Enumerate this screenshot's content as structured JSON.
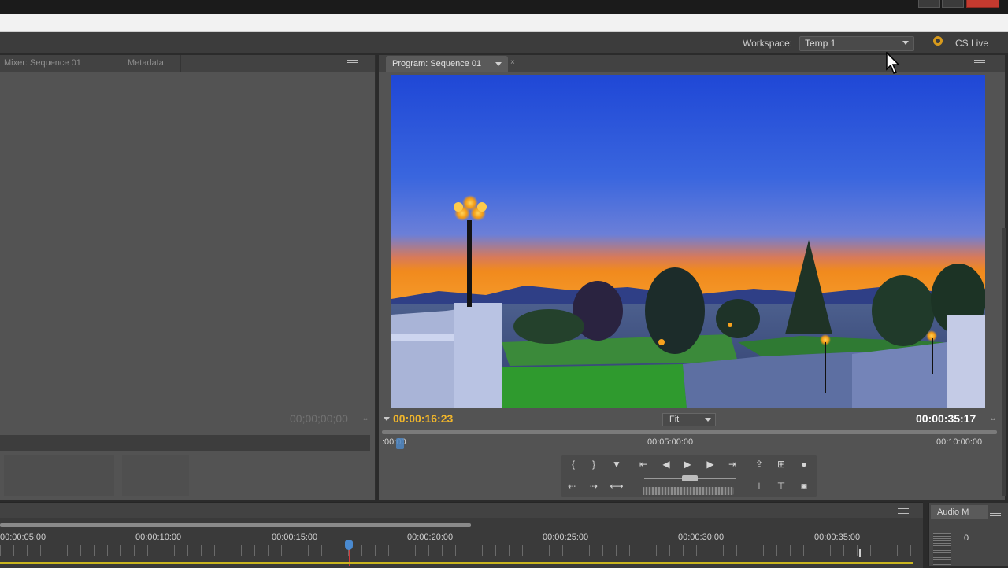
{
  "workspace": {
    "label": "Workspace:",
    "value": "Temp 1",
    "cs_live": "CS Live"
  },
  "left_panel": {
    "tabs": [
      "Mixer: Sequence 01",
      "Metadata"
    ],
    "timecode": "00;00;00;00"
  },
  "program": {
    "tab_label": "Program: Sequence 01",
    "current_timecode": "00:00:16:23",
    "fit_value": "Fit",
    "duration_timecode": "00:00:35:17",
    "ruler": {
      "start": ":00:00",
      "mid": "00:05:00:00",
      "end": "00:10:00:00"
    },
    "transport_icons": [
      "mark-in-icon",
      "mark-out-icon",
      "add-marker-icon",
      "go-to-in-icon",
      "step-back-icon",
      "play-icon",
      "step-forward-icon",
      "go-to-out-icon",
      "export-frame-icon",
      "safe-margins-icon",
      "output-icon",
      "go-to-prev-edit-icon",
      "go-to-next-edit-icon",
      "play-in-to-out-icon",
      "lift-icon",
      "extract-icon",
      "camera-icon"
    ]
  },
  "timeline": {
    "labels": [
      "00:00:05:00",
      "00:00:10:00",
      "00:00:15:00",
      "00:00:20:00",
      "00:00:25:00",
      "00:00:30:00",
      "00:00:35:00"
    ]
  },
  "audio": {
    "tab_label": "Audio M",
    "zero_label": "0"
  },
  "colors": {
    "accent_timecode": "#f0b52b",
    "cs_live_icon": "#d79a1c",
    "playhead": "#4a8ad0"
  }
}
